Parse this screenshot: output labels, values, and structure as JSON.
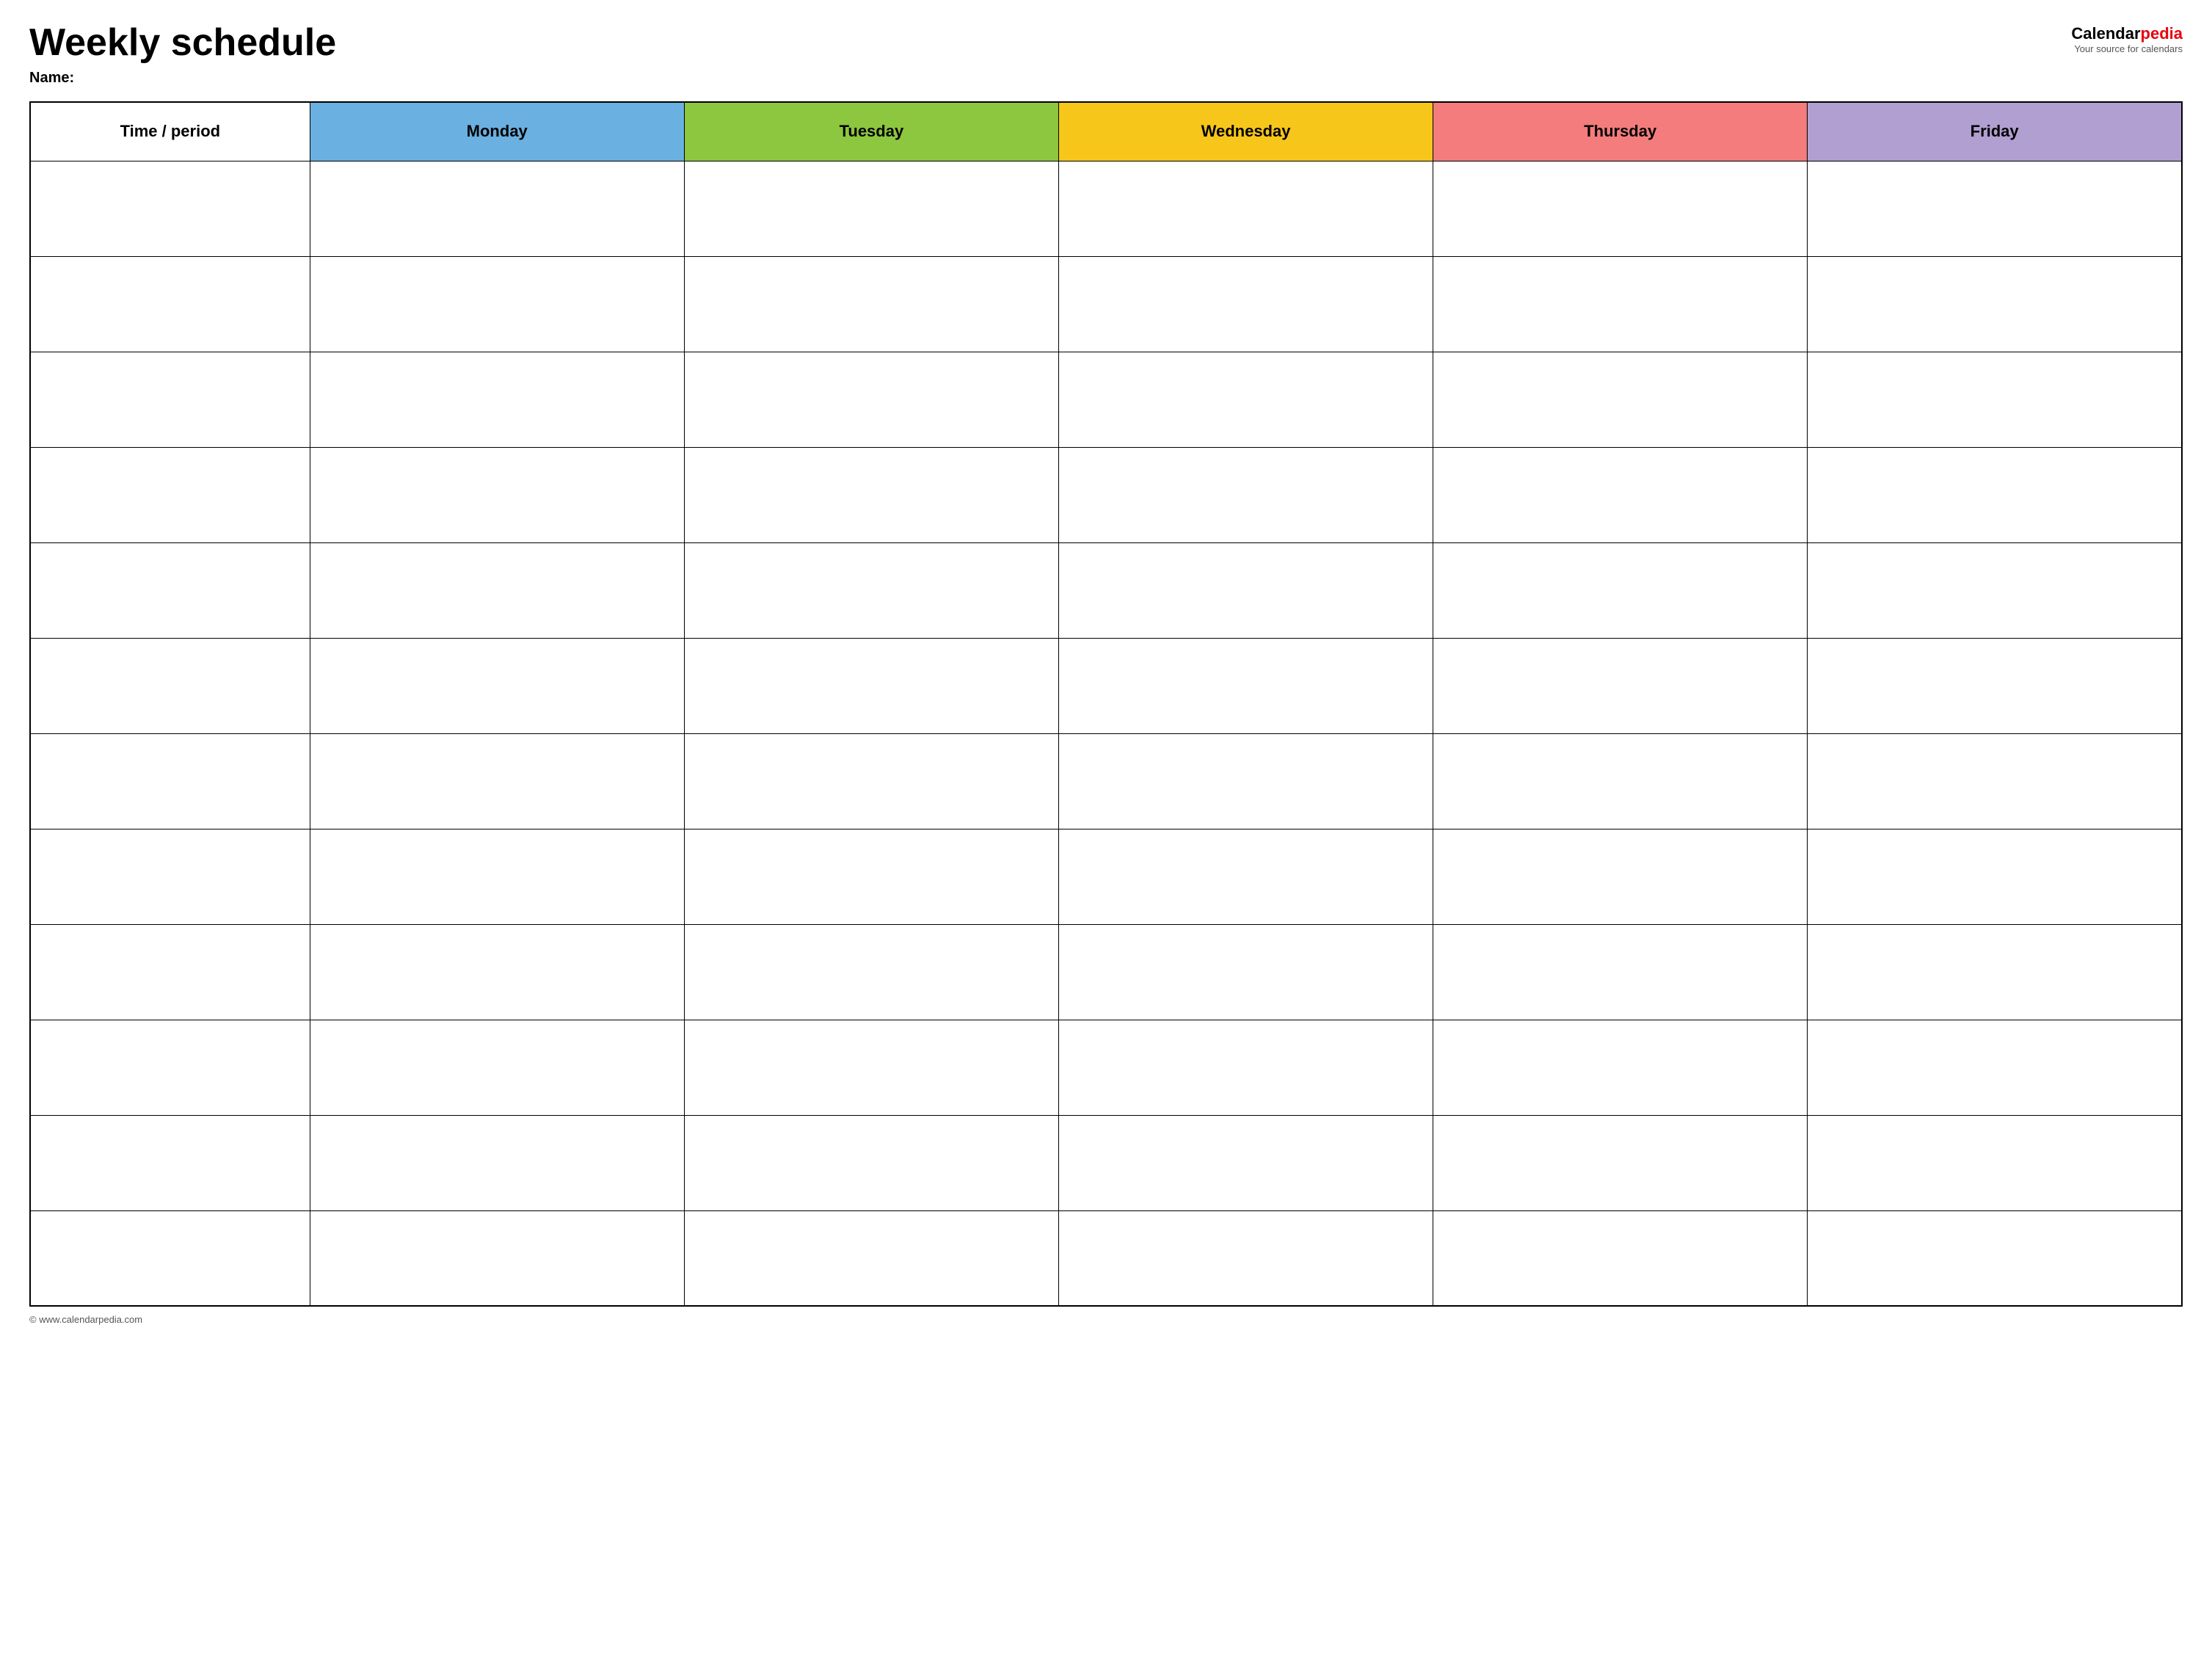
{
  "header": {
    "title": "Weekly schedule",
    "name_label": "Name:",
    "logo_calendar": "Calendar",
    "logo_pedia": "pedia",
    "logo_subtitle": "Your source for calendars"
  },
  "table": {
    "columns": [
      {
        "key": "time",
        "label": "Time / period",
        "color": "#ffffff"
      },
      {
        "key": "monday",
        "label": "Monday",
        "color": "#6ab0e0"
      },
      {
        "key": "tuesday",
        "label": "Tuesday",
        "color": "#8dc63f"
      },
      {
        "key": "wednesday",
        "label": "Wednesday",
        "color": "#f7c61b"
      },
      {
        "key": "thursday",
        "label": "Thursday",
        "color": "#f47c7c"
      },
      {
        "key": "friday",
        "label": "Friday",
        "color": "#b09fd0"
      }
    ],
    "row_count": 12
  },
  "footer": {
    "copyright": "© www.calendarpedia.com"
  }
}
